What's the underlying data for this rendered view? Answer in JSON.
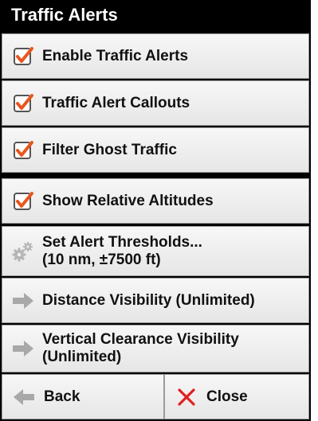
{
  "header": {
    "title": "Traffic Alerts"
  },
  "menu": [
    {
      "label": "Enable Traffic Alerts",
      "icon": "checkbox-checked-icon",
      "checked": true
    },
    {
      "label": "Traffic Alert Callouts",
      "icon": "checkbox-checked-icon",
      "checked": true
    },
    {
      "label": "Filter Ghost Traffic",
      "icon": "checkbox-checked-icon",
      "checked": true
    },
    {
      "label": "Show Relative Altitudes",
      "icon": "checkbox-checked-icon",
      "checked": true
    },
    {
      "label": "Set Alert Thresholds...\n(10 nm, ±7500 ft)",
      "icon": "gears-icon"
    },
    {
      "label": "Distance Visibility (Unlimited)",
      "icon": "arrow-right-icon"
    },
    {
      "label": "Vertical Clearance Visibility\n(Unlimited)",
      "icon": "arrow-right-icon"
    }
  ],
  "footer": {
    "back_label": "Back",
    "back_icon": "arrow-left-icon",
    "close_label": "Close",
    "close_icon": "close-x-icon"
  },
  "colors": {
    "checkmark": "#e8561e",
    "background": "#000000",
    "button": "#eeeeee",
    "arrow": "#a8a8a8",
    "close_x": "#e02020"
  }
}
